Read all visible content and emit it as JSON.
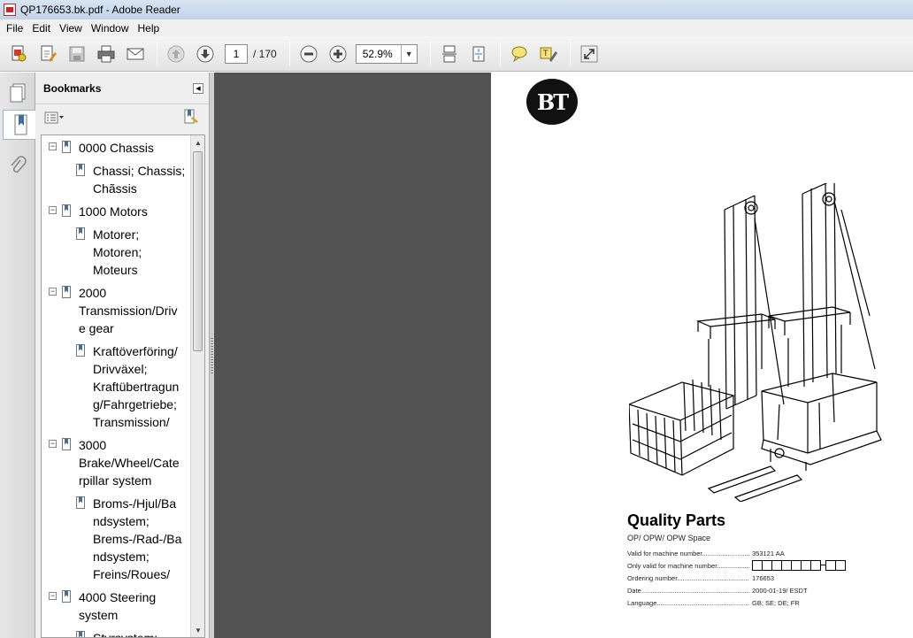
{
  "window": {
    "title": "QP176653.bk.pdf - Adobe Reader"
  },
  "menu": [
    "File",
    "Edit",
    "View",
    "Window",
    "Help"
  ],
  "toolbar": {
    "page_current": "1",
    "page_total": "/ 170",
    "zoom": "52.9%"
  },
  "bookmarks": {
    "title": "Bookmarks",
    "items": [
      {
        "level": 0,
        "lines": [
          "0000 Chassis"
        ]
      },
      {
        "level": 1,
        "lines": [
          "Chassi; Chassis;",
          "Chãssis"
        ]
      },
      {
        "level": 0,
        "lines": [
          "1000 Motors"
        ]
      },
      {
        "level": 1,
        "lines": [
          "Motorer;",
          "Motoren;",
          "Moteurs"
        ]
      },
      {
        "level": 0,
        "lines": [
          "2000",
          "Transmission/Driv",
          "e gear"
        ]
      },
      {
        "level": 1,
        "lines": [
          "Kraftöverföring/",
          "Drivväxel;",
          "Kraftübertragun",
          "g/Fahrgetriebe;",
          "Transmission/"
        ]
      },
      {
        "level": 0,
        "lines": [
          "3000",
          "Brake/Wheel/Cate",
          "rpillar system"
        ]
      },
      {
        "level": 1,
        "lines": [
          "Broms-/Hjul/Ba",
          "ndsystem;",
          "Brems-/Rad-/Ba",
          "ndsystem;",
          "Freins/Roues/"
        ]
      },
      {
        "level": 0,
        "lines": [
          "4000 Steering",
          "system"
        ]
      },
      {
        "level": 1,
        "lines": [
          "Styrsystem;"
        ]
      }
    ]
  },
  "document": {
    "logo_text": "BT",
    "title": "Quality Parts",
    "subtitle": "OP/ OPW/ OPW Space",
    "rows": [
      {
        "label": "Valid for machine number",
        "value": "353121 AA"
      },
      {
        "label": "Only valid for machine number",
        "value": ""
      },
      {
        "label": "Ordering number",
        "value": "176653"
      },
      {
        "label": "Date",
        "value": "2000-01-19/ ESDT"
      },
      {
        "label": "Language",
        "value": "GB; SE; DE; FR"
      }
    ]
  }
}
